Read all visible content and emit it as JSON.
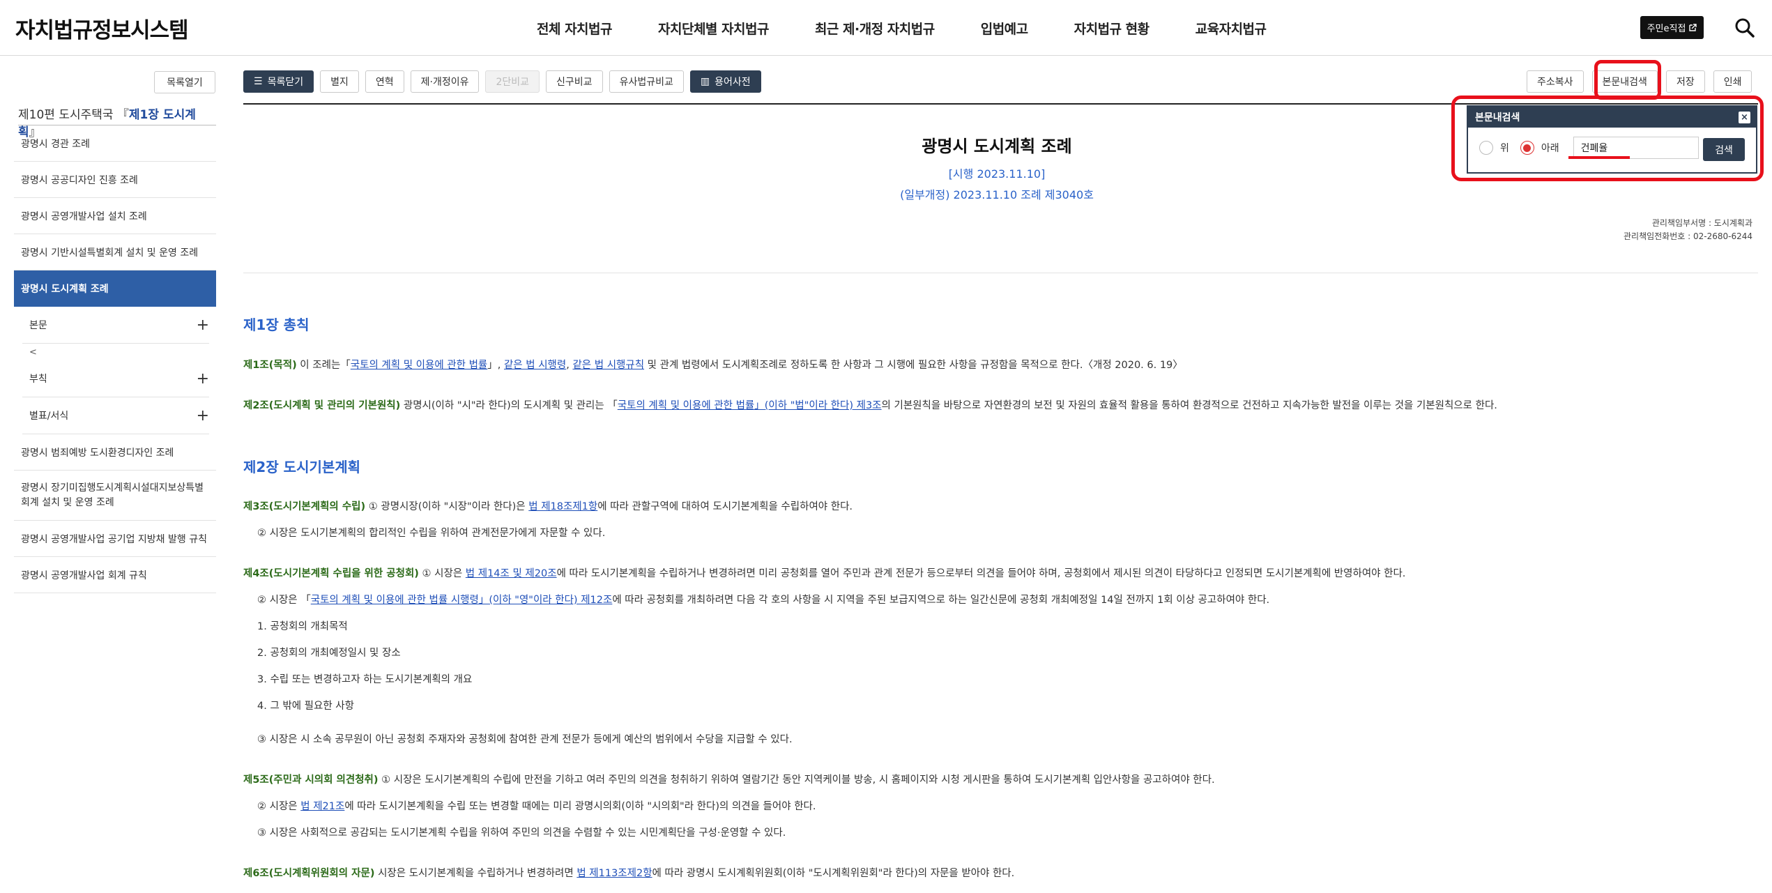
{
  "header": {
    "logo": "자치법규정보시스템",
    "nav": [
      "전체 자치법규",
      "자치단체별 자치법규",
      "최근 제·개정 자치법규",
      "입법예고",
      "자치법규 현황",
      "교육자치법규"
    ],
    "direct_btn": "주민e직접",
    "search_icon": "search-icon"
  },
  "sidebar": {
    "toc_open": "목록열기",
    "chapter_prefix": "제10편 도시주택국 『",
    "chapter_name": "제1장 도시계획",
    "chapter_suffix": "』",
    "items_before": [
      "광명시 경관 조례",
      "광명시 공공디자인 진흥 조례",
      "광명시 공영개발사업 설치 조례",
      "광명시 기반시설특별회계 설치 및 운영 조례"
    ],
    "active": "광명시 도시계획 조례",
    "sub": {
      "main": "본문",
      "lt": "<",
      "appendix": "부칙",
      "table": "별표/서식",
      "plus": "+"
    },
    "items_after": [
      "광명시 범죄예방 도시환경디자인 조례",
      "광명시 장기미집행도시계획시설대지보상특별회계 설치 및 운영 조례",
      "광명시 공영개발사업 공기업 지방채 발행 규칙",
      "광명시 공영개발사업 회계 규칙"
    ]
  },
  "toolbar": {
    "toc_close": "목록닫기",
    "appendix": "별지",
    "history": "연혁",
    "reason": "제·개정이유",
    "two_col": "2단비교",
    "new_old": "신구비교",
    "similar": "유사법규비교",
    "dictionary": "용어사전",
    "copy_addr": "주소복사",
    "body_search": "본문내검색",
    "save": "저장",
    "print": "인쇄"
  },
  "search_panel": {
    "title": "본문내검색",
    "close": "×",
    "opt_up": "위",
    "opt_down": "아래",
    "query": "건폐율",
    "button": "검색",
    "selected": "down"
  },
  "doc": {
    "title": "광명시 도시계획 조례",
    "enforce": "[시행 2023.11.10]",
    "amend": "(일부개정) 2023.11.10 조례 제3040호",
    "manager_dept": "관리책임부서명 : 도시계획과",
    "manager_tel": "관리책임전화번호 : 02-2680-6244"
  },
  "content": {
    "ch1": "제1장 총칙",
    "a1_title": "제1조(목적)",
    "a1_t1": " 이 조례는「",
    "a1_l1": "국토의 계획 및 이용에 관한 법률",
    "a1_t2": "」, ",
    "a1_l2": "같은 법 시행령",
    "a1_t3": ", ",
    "a1_l3": "같은 법 시행규칙",
    "a1_t4": " 및 관계 법령에서 도시계획조례로 정하도록 한 사항과 그 시행에 필요한 사항을 규정함을 목적으로 한다.〈개정 2020. 6. 19〉",
    "a2_title": "제2조(도시계획 및 관리의 기본원칙)",
    "a2_t1": " 광명시(이하 \"시\"라 한다)의 도시계획 및 관리는 「",
    "a2_l1": "국토의 계획 및 이용에 관한 법률」(이하 \"법\"이라 한다) 제3조",
    "a2_t2": "의 기본원칙을 바탕으로 자연환경의 보전 및 자원의 효율적 활용을 통하여 환경적으로 건전하고 지속가능한 발전을 이루는 것을 기본원칙으로 한다.",
    "ch2": "제2장 도시기본계획",
    "a3_title": "제3조(도시기본계획의 수립)",
    "a3_t1": " ① 광명시장(이하 \"시장\"이라 한다)은 ",
    "a3_l1": "법 제18조제1항",
    "a3_t2": "에 따라 관할구역에 대하여 도시기본계획을 수립하여야 한다.",
    "a3_p2": "② 시장은 도시기본계획의 합리적인 수립을 위하여 관계전문가에게 자문할 수 있다.",
    "a4_title": "제4조(도시기본계획 수립을 위한 공청회)",
    "a4_t1": " ① 시장은 ",
    "a4_l1": "법 제14조 및 제20조",
    "a4_t2": "에 따라 도시기본계획을 수립하거나 변경하려면 미리 공청회를 열어 주민과 관계 전문가 등으로부터 의견을 들어야 하며, 공청회에서 제시된 의견이 타당하다고 인정되면 도시기본계획에 반영하여야 한다.",
    "a4_p2_t1": "② 시장은 「",
    "a4_p2_l1": "국토의 계획 및 이용에 관한 법률 시행령」(이하 \"영\"이라 한다) 제12조",
    "a4_p2_t2": "에 따라 공청회를 개최하려면 다음 각 호의 사항을 시 지역을 주된 보급지역으로 하는 일간신문에 공청회 개최예정일 14일 전까지 1회 이상 공고하여야 한다.",
    "a4_i1": "1. 공청회의 개최목적",
    "a4_i2": "2. 공청회의 개최예정일시 및 장소",
    "a4_i3": "3. 수립 또는 변경하고자 하는 도시기본계획의 개요",
    "a4_i4": "4. 그 밖에 필요한 사항",
    "a4_p3": "③ 시장은 시 소속 공무원이 아닌 공청회 주재자와 공청회에 참여한 관계 전문가 등에게 예산의 범위에서 수당을 지급할 수 있다.",
    "a5_title": "제5조(주민과 시의회 의견청취)",
    "a5_t1": " ① 시장은 도시기본계획의 수립에 만전을 기하고 여러 주민의 의견을 청취하기 위하여 열람기간 동안 지역케이블 방송, 시 홈페이지와 시청 게시판을 통하여 도시기본계획 입안사항을 공고하여야 한다.",
    "a5_p2_t1": "② 시장은 ",
    "a5_p2_l1": "법 제21조",
    "a5_p2_t2": "에 따라 도시기본계획을 수립 또는 변경할 때에는 미리 광명시의회(이하 \"시의회\"라 한다)의 의견을 들어야 한다.",
    "a5_p3": "③ 시장은 사회적으로 공감되는 도시기본계획 수립을 위하여 주민의 의견을 수렴할 수 있는 시민계획단을 구성·운영할 수 있다.",
    "a6_title": "제6조(도시계획위원회의 자문)",
    "a6_t1": " 시장은 도시기본계획을 수립하거나 변경하려면 ",
    "a6_l1": "법 제113조제2항",
    "a6_t2": "에 따라 광명시 도시계획위원회(이하 \"도시계획위원회\"라 한다)의 자문을 받아야 한다."
  },
  "colors": {
    "accent": "#2a62c9",
    "sidebar_active": "#2e5fa6",
    "dark_button": "#2e3e52",
    "article": "#2b6a18",
    "annotation": "#e8101b"
  }
}
